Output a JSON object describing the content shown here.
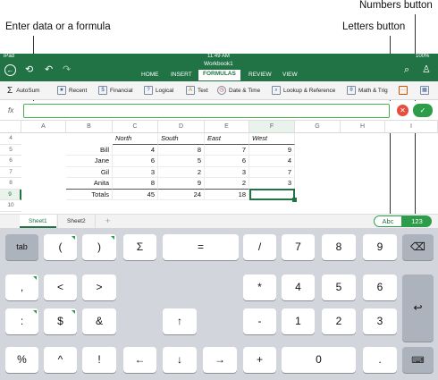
{
  "callouts": {
    "formula": "Enter data or a formula",
    "letters": "Letters button",
    "numbers": "Numbers button"
  },
  "status": {
    "device": "iPad",
    "time": "11:49 AM",
    "battery": "100%"
  },
  "workbook": "Workbook1",
  "tabs": [
    "HOME",
    "INSERT",
    "FORMULAS",
    "REVIEW",
    "VIEW"
  ],
  "ribbon": [
    {
      "label": "AutoSum",
      "icon": "sigma-icon"
    },
    {
      "label": "Recent",
      "icon": "star-icon"
    },
    {
      "label": "Financial",
      "icon": "financial-icon"
    },
    {
      "label": "Logical",
      "icon": "logical-icon"
    },
    {
      "label": "Text",
      "icon": "text-icon"
    },
    {
      "label": "Date & Time",
      "icon": "clock-icon"
    },
    {
      "label": "Lookup & Reference",
      "icon": "lookup-icon"
    },
    {
      "label": "Math & Trig",
      "icon": "math-icon"
    }
  ],
  "formula_bar": {
    "fx": "fx",
    "value": ""
  },
  "columns": [
    "A",
    "B",
    "C",
    "D",
    "E",
    "F",
    "G",
    "H",
    "I"
  ],
  "rows": [
    "4",
    "5",
    "6",
    "7",
    "8",
    "9",
    "10"
  ],
  "region_headers": [
    "North",
    "South",
    "East",
    "West"
  ],
  "data_rows": [
    {
      "name": "Bill",
      "v": [
        "4",
        "8",
        "7",
        "9"
      ]
    },
    {
      "name": "Jane",
      "v": [
        "6",
        "5",
        "6",
        "4"
      ]
    },
    {
      "name": "Gil",
      "v": [
        "3",
        "2",
        "3",
        "7"
      ]
    },
    {
      "name": "Anita",
      "v": [
        "8",
        "9",
        "2",
        "3"
      ]
    }
  ],
  "totals": {
    "label": "Totals",
    "v": [
      "45",
      "24",
      "18",
      ""
    ]
  },
  "sheets": [
    "Sheet1",
    "Sheet2",
    "+"
  ],
  "kb_mode": {
    "letters": "Abc",
    "numbers": "123"
  },
  "keys": {
    "r1": [
      "tab",
      "(",
      ")",
      "Σ",
      "=",
      "/",
      "7",
      "8",
      "9"
    ],
    "r2": [
      ",",
      "<",
      ">",
      "*",
      "4",
      "5",
      "6"
    ],
    "r3": [
      ":",
      "$",
      "&",
      "↑",
      "-",
      "1",
      "2",
      "3"
    ],
    "r4": [
      "%",
      "^",
      "!",
      "←",
      "↓",
      "→",
      "+",
      "0",
      "."
    ]
  },
  "colors": {
    "accent": "#217346",
    "green": "#2e9d4a",
    "cancel": "#e74c3c"
  }
}
